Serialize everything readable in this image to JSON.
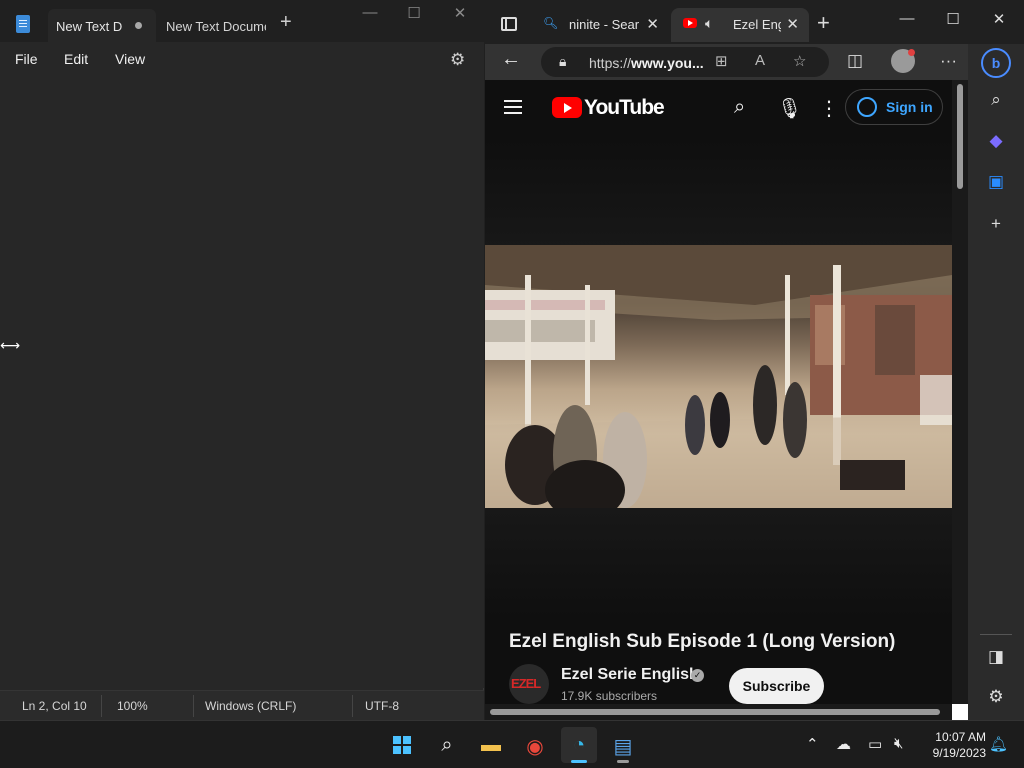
{
  "notepad": {
    "tabs": [
      {
        "label": "New Text D",
        "modified": true
      },
      {
        "label": "New Text Docume"
      }
    ],
    "new_tab": "+",
    "window_controls": [
      "—",
      "☐",
      "✕"
    ],
    "menu": [
      "File",
      "Edit",
      "View"
    ],
    "settings_icon": "⚙",
    "content": "",
    "status": {
      "position": "Ln 2, Col 10",
      "zoom": "100%",
      "line_endings": "Windows (CRLF)",
      "encoding": "UTF-8"
    }
  },
  "edge": {
    "tabs": [
      {
        "label": "ninite - Search",
        "icon": "search-icon"
      },
      {
        "label": "Ezel English",
        "icon": "youtube-icon",
        "audio": true
      }
    ],
    "new_tab": "+",
    "window_controls": [
      "—",
      "☐",
      "✕"
    ],
    "url": {
      "prefix": "https://",
      "host": "www.you..."
    },
    "toolbar_icons": [
      "split-screen-icon",
      "profile-icon",
      "more-icon"
    ],
    "sidebar_icons": [
      "bing-icon",
      "search-icon",
      "copilot-icon",
      "outlook-icon",
      "add-icon",
      "hide-sidebar-icon",
      "settings-icon"
    ]
  },
  "youtube": {
    "logo_text": "YouTube",
    "sign_in": "Sign in",
    "video_title": "Ezel English Sub Episode 1 (Long Version)",
    "channel_name": "Ezel Serie English",
    "channel_avatar_text": "EZEL",
    "subscribers": "17.9K subscribers",
    "subscribe": "Subscribe",
    "colors": {
      "brand_red": "#ff0000",
      "link_blue": "#3ea6ff"
    }
  },
  "taskbar": {
    "apps": [
      "start-icon",
      "search-icon",
      "file-explorer-icon",
      "chrome-icon",
      "edge-icon",
      "notepad-icon"
    ],
    "tray": [
      "chevron-up-icon",
      "onedrive-icon",
      "network-icon",
      "volume-muted-icon"
    ],
    "time": "10:07 AM",
    "date": "9/19/2023",
    "accent": "#4cc2ff"
  }
}
